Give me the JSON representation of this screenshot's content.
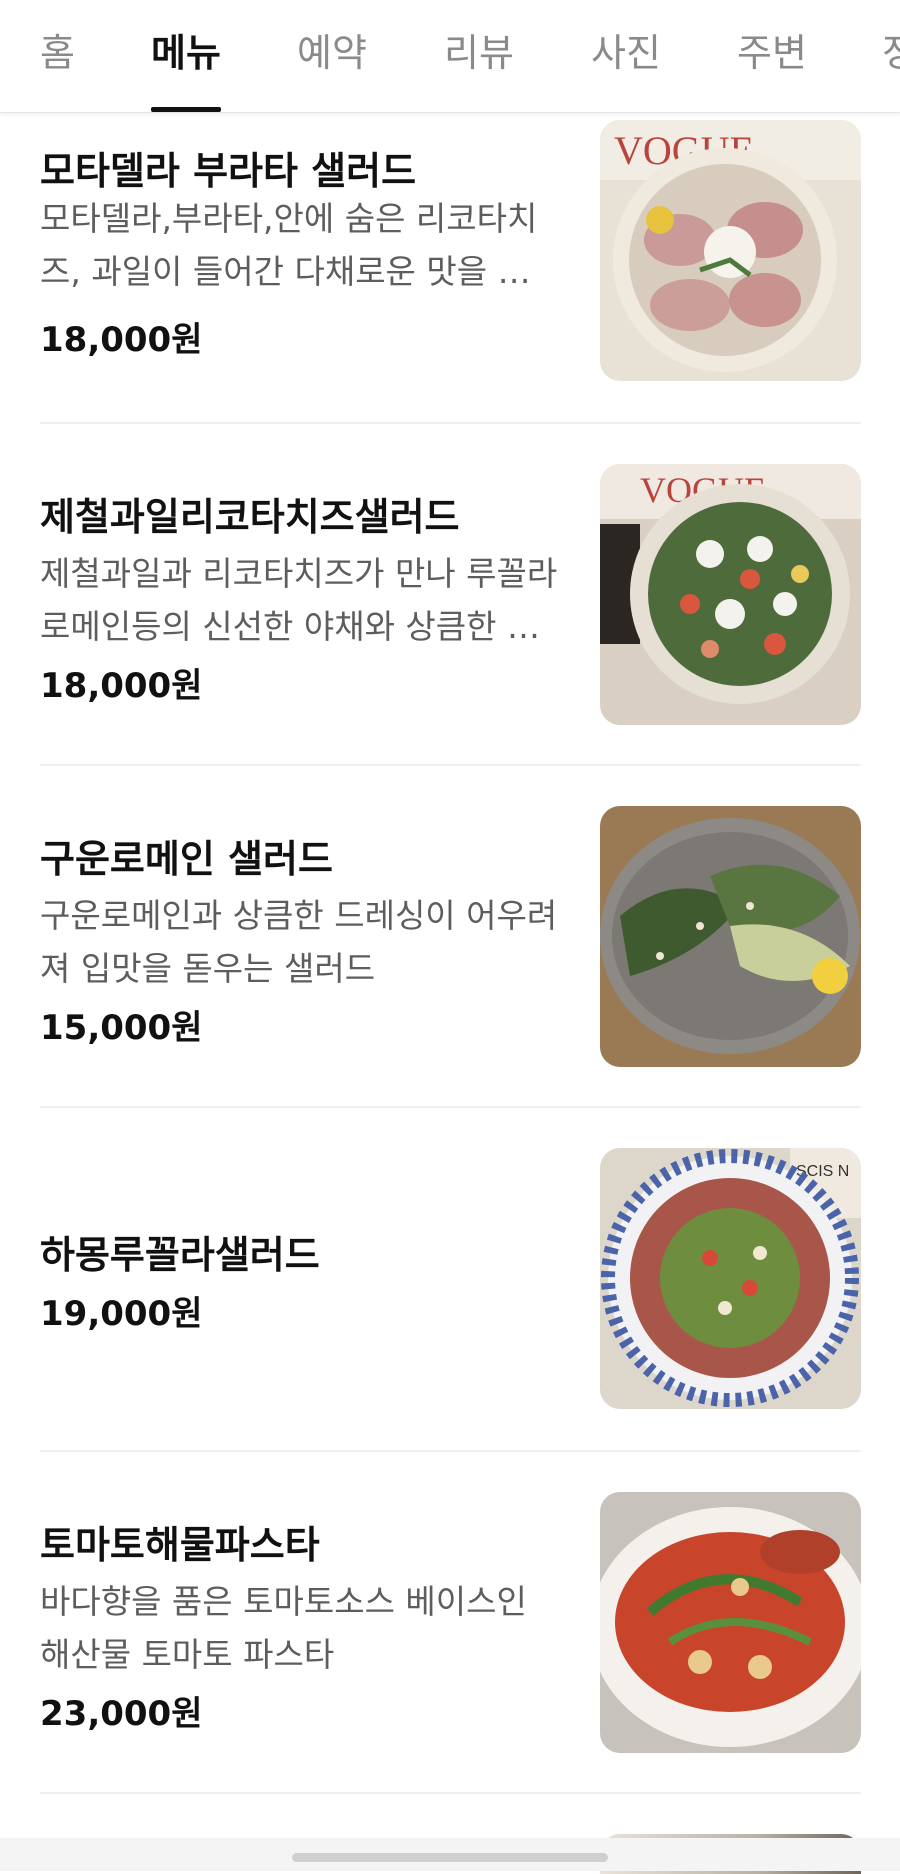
{
  "tabs": [
    {
      "label": "홈",
      "active": false
    },
    {
      "label": "메뉴",
      "active": true
    },
    {
      "label": "예약",
      "active": false
    },
    {
      "label": "리뷰",
      "active": false
    },
    {
      "label": "사진",
      "active": false
    },
    {
      "label": "주변",
      "active": false
    },
    {
      "label": "정",
      "active": false
    }
  ],
  "menu": {
    "items": [
      {
        "name": "모타델라 부라타 샐러드",
        "description": "모타델라,부라타,안에 숨은 리코타치즈, 과일이 들어간 다채로운 맛을 내는 샐러드",
        "price": "18,000원",
        "image": "mortadella-burrata-salad-photo"
      },
      {
        "name": "제철과일리코타치즈샐러드",
        "description": "제철과일과 리코타치즈가 만나 루꼴라 로메인등의 신선한 야채와 상큼한 드레싱",
        "price": "18,000원",
        "image": "seasonal-fruit-ricotta-salad-photo"
      },
      {
        "name": "구운로메인 샐러드",
        "description": "구운로메인과 상큼한 드레싱이 어우려져 입맛을 돋우는 샐러드",
        "price": "15,000원",
        "image": "grilled-romaine-salad-photo"
      },
      {
        "name": "하몽루꼴라샐러드",
        "description": "",
        "price": "19,000원",
        "image": "jamon-arugula-salad-photo"
      },
      {
        "name": "토마토해물파스타",
        "description": "바다향을 품은 토마토소스 베이스인 해산물 토마토 파스타",
        "price": "23,000원",
        "image": "tomato-seafood-pasta-photo"
      }
    ]
  },
  "colors": {
    "text_primary": "#111111",
    "text_secondary": "#5d5d5d",
    "tab_inactive": "#8a8a8a",
    "divider": "#efefef"
  }
}
